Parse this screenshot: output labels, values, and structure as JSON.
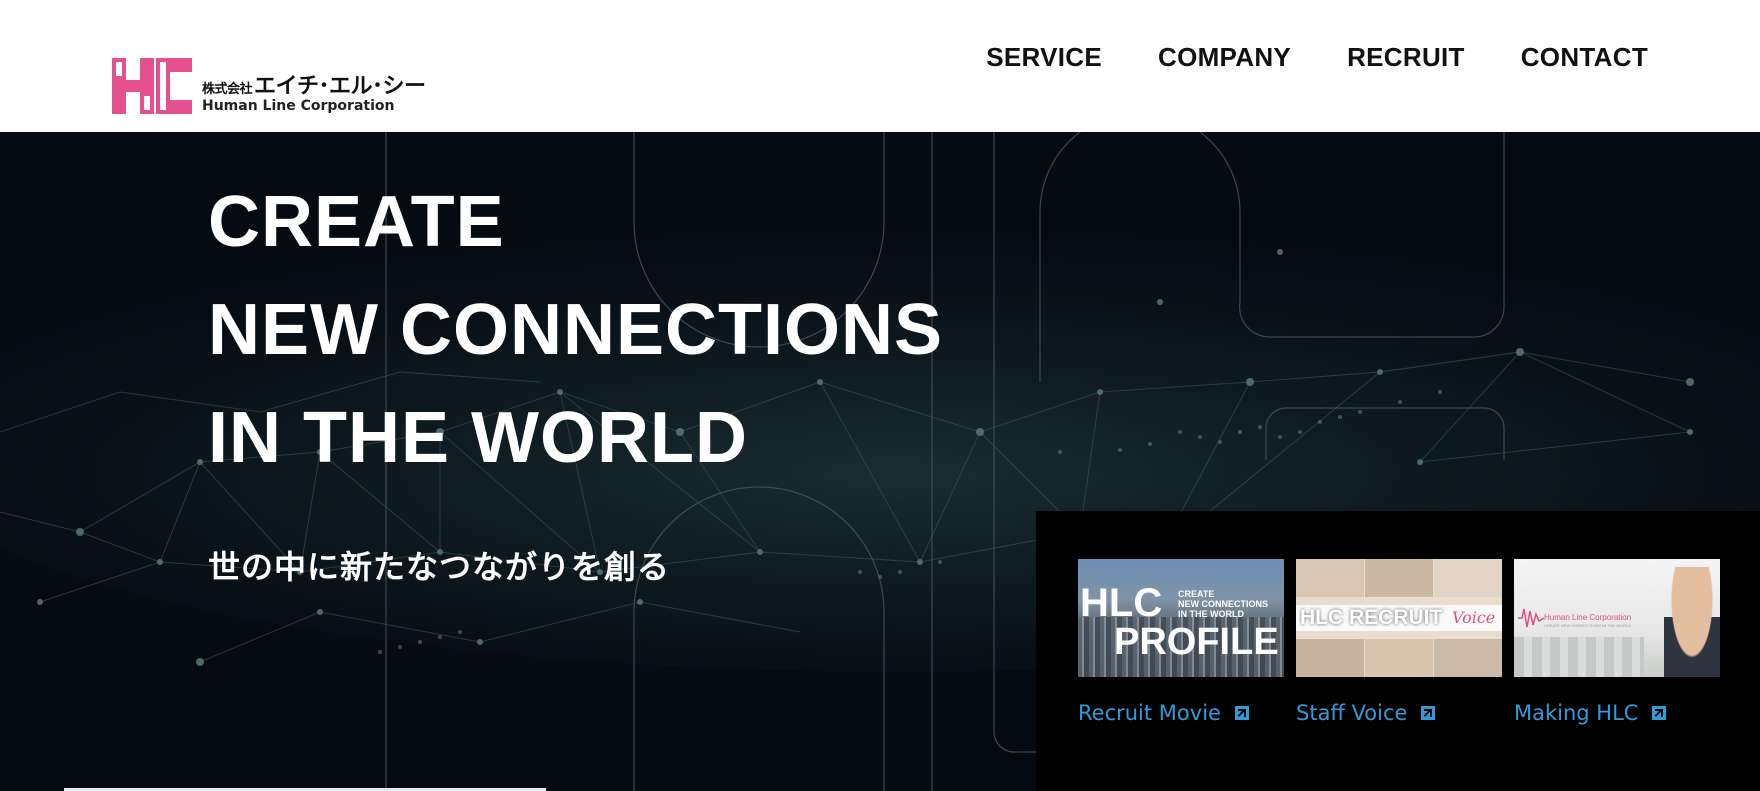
{
  "header": {
    "logo": {
      "mark": "HLC",
      "jp_prefix": "株式会社",
      "jp_name": "エイチ･エル･シー",
      "en_name": "Human Line Corporation"
    },
    "nav": [
      {
        "label": "SERVICE"
      },
      {
        "label": "COMPANY"
      },
      {
        "label": "RECRUIT"
      },
      {
        "label": "CONTACT"
      }
    ]
  },
  "hero": {
    "title_lines": [
      "CREATE",
      "NEW CONNECTIONS",
      "IN THE WORLD"
    ],
    "subtitle": "世の中に新たなつながりを創る"
  },
  "videos": [
    {
      "label": "Recruit Movie",
      "thumb": {
        "big": "HLC",
        "small": [
          "CREATE",
          "NEW CONNECTIONS",
          "IN THE WORLD"
        ],
        "profile": "PROFILE"
      }
    },
    {
      "label": "Staff Voice",
      "thumb": {
        "title": "HLC RECRUIT",
        "voice": "Voice"
      }
    },
    {
      "label": "Making HLC",
      "thumb": {
        "brand": "Human Line Corporation",
        "tagline": "CREATE NEW CONNECTIONS IN THE WORLD"
      }
    }
  ],
  "colors": {
    "brand_pink": "#e5508f",
    "hero_bg": "#060b12",
    "link_blue": "#2f9bd8",
    "nav_text": "#111111"
  }
}
